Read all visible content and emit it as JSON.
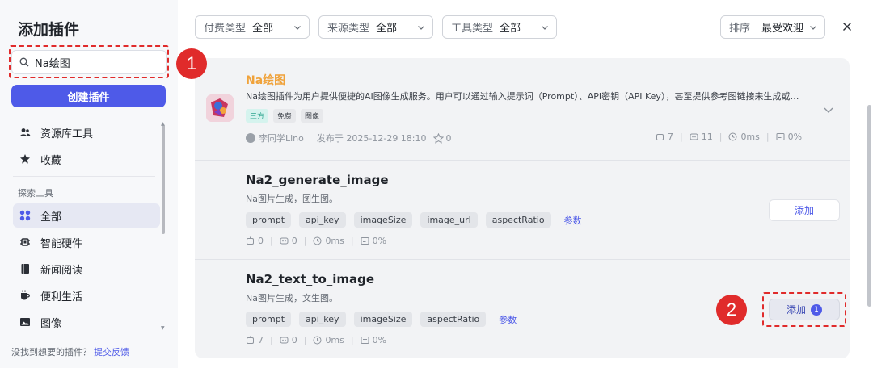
{
  "sidebar": {
    "title": "添加插件",
    "search_value": "Na绘图",
    "create_label": "创建插件",
    "items_top": [
      {
        "label": "资源库工具",
        "icon": "users-icon"
      },
      {
        "label": "收藏",
        "icon": "star-icon"
      }
    ],
    "section_label": "探索工具",
    "items": [
      {
        "label": "全部",
        "icon": "grid-icon",
        "active": true
      },
      {
        "label": "智能硬件",
        "icon": "chip-icon"
      },
      {
        "label": "新闻阅读",
        "icon": "book-icon"
      },
      {
        "label": "便利生活",
        "icon": "coffee-icon"
      },
      {
        "label": "图像",
        "icon": "image-icon"
      }
    ],
    "footer_text": "没找到想要的插件？",
    "footer_link": "提交反馈"
  },
  "filters": {
    "pay": {
      "label": "付费类型",
      "value": "全部"
    },
    "source": {
      "label": "来源类型",
      "value": "全部"
    },
    "tool": {
      "label": "工具类型",
      "value": "全部"
    },
    "sort": {
      "label": "排序",
      "value": "最受欢迎"
    }
  },
  "plugin": {
    "name": "Na绘图",
    "desc": "Na绘图插件为用户提供便捷的AI图像生成服务。用户可以通过输入提示词（Prompt）、API密钥（API Key），甚至提供参考图链接来生成或…",
    "tags": [
      "三方",
      "免费",
      "图像"
    ],
    "author": "李同学Lino",
    "published": "发布于 2025-12-29 18:10",
    "stars": "0",
    "stats": {
      "a": "7",
      "b": "11",
      "c": "0ms",
      "d": "0%"
    }
  },
  "tools": [
    {
      "name": "Na2_generate_image",
      "desc": "Na图片生成，图生图。",
      "params": [
        "prompt",
        "api_key",
        "imageSize",
        "image_url",
        "aspectRatio"
      ],
      "params_link": "参数",
      "stats": {
        "a": "0",
        "b": "0",
        "c": "0ms",
        "d": "0%"
      },
      "add_label": "添加",
      "badge": ""
    },
    {
      "name": "Na2_text_to_image",
      "desc": "Na图片生成，文生图。",
      "params": [
        "prompt",
        "api_key",
        "imageSize",
        "aspectRatio"
      ],
      "params_link": "参数",
      "stats": {
        "a": "7",
        "b": "0",
        "c": "0ms",
        "d": "0%"
      },
      "add_label": "添加",
      "badge": "1"
    }
  ],
  "annotations": {
    "step1": "1",
    "step2": "2",
    "color": "#e02b2b"
  },
  "colors": {
    "accent": "#4e5ae8",
    "plugin_name": "#f0a23a",
    "tag_third": "#2ea58f"
  }
}
